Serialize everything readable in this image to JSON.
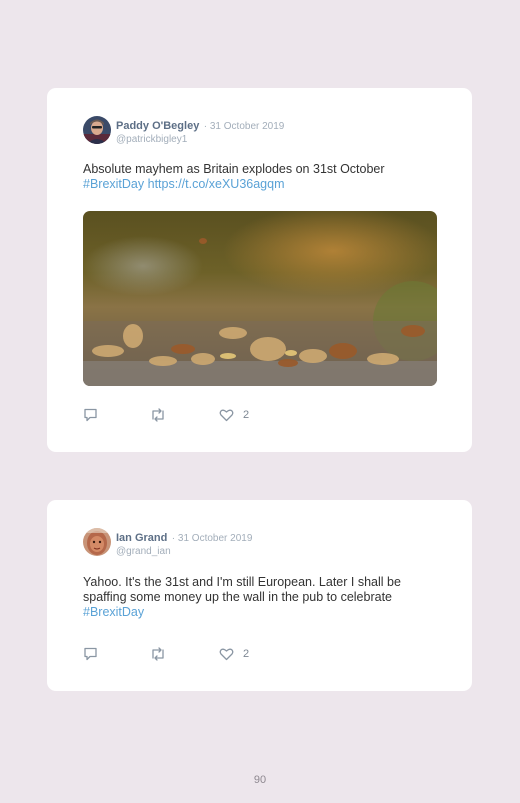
{
  "tweets": [
    {
      "name": "Paddy O'Begley",
      "date": "· 31 October 2019",
      "handle": "@patrickbigley1",
      "text": "Absolute mayhem as Britain explodes on 31st October",
      "hashtag": "#BrexitDay",
      "link": "https://t.co/xeXU36agqm",
      "likes": "2"
    },
    {
      "name": "Ian Grand",
      "date": "· 31 October 2019",
      "handle": "@grand_ian",
      "text": "Yahoo. It's the 31st and I'm still European. Later I shall be spaffing some money up the wall in the pub to celebrate",
      "hashtag": "#BrexitDay",
      "likes": "2"
    }
  ],
  "page": {
    "number": "90"
  },
  "icons": {
    "reply": "reply-icon",
    "retweet": "retweet-icon",
    "like": "heart-icon"
  },
  "colors": {
    "background": "#ede6ec",
    "card": "#ffffff",
    "name": "#5d6f86",
    "link": "#5aa2d6",
    "muted": "#a3aeba"
  }
}
